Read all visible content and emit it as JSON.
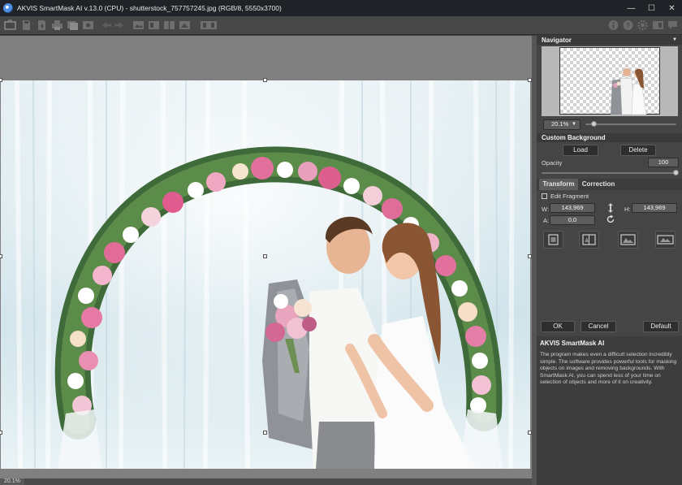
{
  "window": {
    "title": "AKVIS SmartMask AI v.13.0 (CPU) - shutterstock_757757245.jpg (RGB/8, 5550x3700)",
    "controls": [
      "minimize",
      "maximize",
      "close"
    ],
    "minimize_glyph": "—",
    "maximize_glyph": "☐",
    "close_glyph": "✕"
  },
  "toolbar": {
    "left_icons": [
      "open-icon",
      "save-icon",
      "export-icon",
      "print-icon",
      "batch-icon",
      "share-icon",
      "undo-icon",
      "redo-icon",
      "before-icon",
      "after-icon",
      "compare-icon",
      "split-icon",
      "background-icon"
    ],
    "right_icons": [
      "info-icon",
      "help-icon",
      "settings-icon",
      "minimize-panel-icon",
      "feedback-icon"
    ]
  },
  "navigator": {
    "header": "Navigator",
    "zoom_value": "20.1%",
    "zoom_level": 0.1
  },
  "custom_background": {
    "header": "Custom Background",
    "load_label": "Load",
    "delete_label": "Delete",
    "opacity_label": "Opacity",
    "opacity_value": "100",
    "opacity_level": 1.0
  },
  "tabs": [
    {
      "label": "Transform",
      "active": true
    },
    {
      "label": "Correction",
      "active": false
    }
  ],
  "transform": {
    "edit_fragment_label": "Edit Fragment",
    "edit_fragment_checked": false,
    "w_label": "W:",
    "w_value": "143,969",
    "h_label": "H:",
    "h_value": "143,969",
    "a_label": "A:",
    "a_value": "0,0",
    "tool_icons": [
      "fit-icon",
      "flip-icon",
      "fill-icon",
      "stretch-icon"
    ]
  },
  "actions": {
    "ok_label": "OK",
    "cancel_label": "Cancel",
    "default_label": "Default"
  },
  "help": {
    "title": "AKVIS SmartMask AI",
    "body": "The program makes even a difficult selection incredibly simple. The software provides powerful tools for masking objects on images and removing backgrounds. With SmartMask AI, you can spend less of your time on selection of objects and more of it on creativity."
  },
  "status": {
    "zoom": "20.1%"
  },
  "colors": {
    "titlebar": "#1f2226",
    "panel": "#454545",
    "canvas_bg": "#808080",
    "button": "#2e2e2e"
  }
}
